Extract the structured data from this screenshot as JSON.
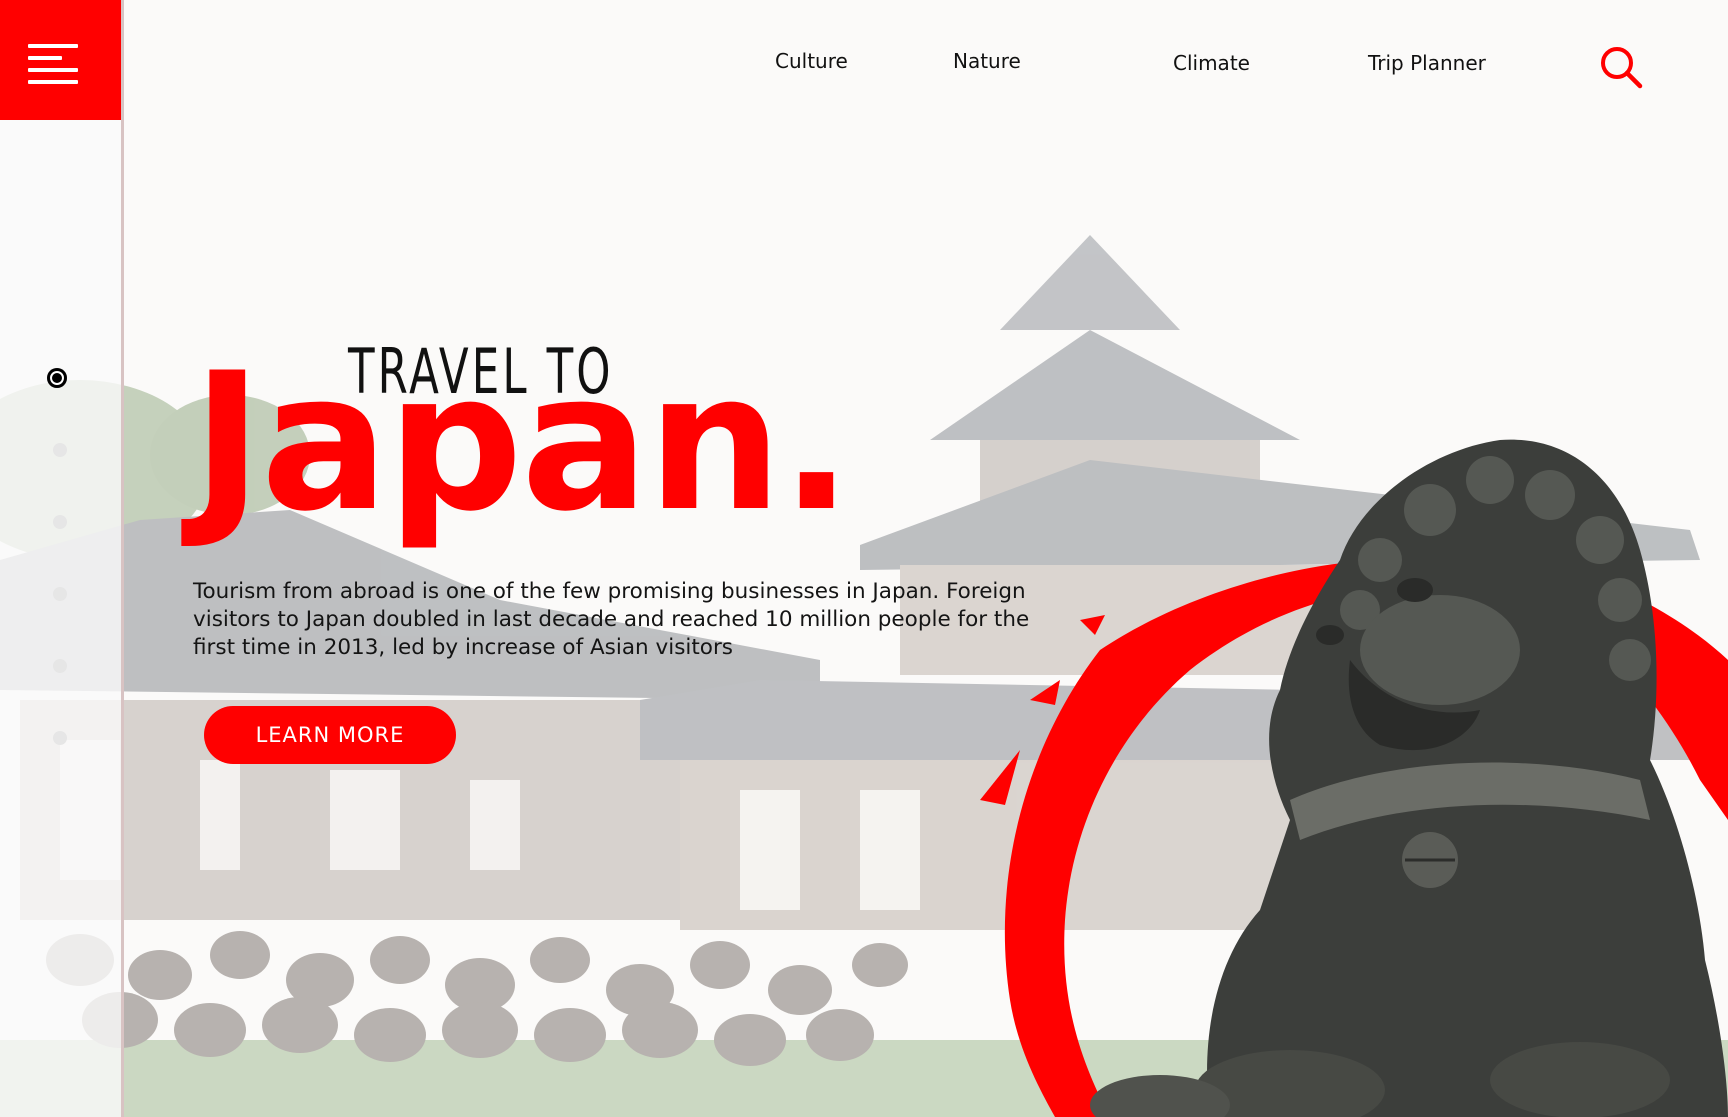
{
  "nav": {
    "items": [
      "Culture",
      "Nature",
      "Climate",
      "Trip Planner"
    ]
  },
  "icons": {
    "menu": "hamburger-menu-icon",
    "search": "search-icon"
  },
  "colors": {
    "accent": "#ff0000",
    "text": "#141414",
    "background": "#fbfaf9"
  },
  "pager": {
    "count": 6,
    "active_index": 0
  },
  "hero": {
    "kicker": "TRAVEL TO",
    "title": "Japan.",
    "description": "Tourism from abroad is one of the few promising businesses in Japan. Foreign visitors to Japan doubled in last decade and reached 10 million people for the first time in 2013, led by increase of Asian visitors",
    "cta_label": "LEARN MORE"
  }
}
